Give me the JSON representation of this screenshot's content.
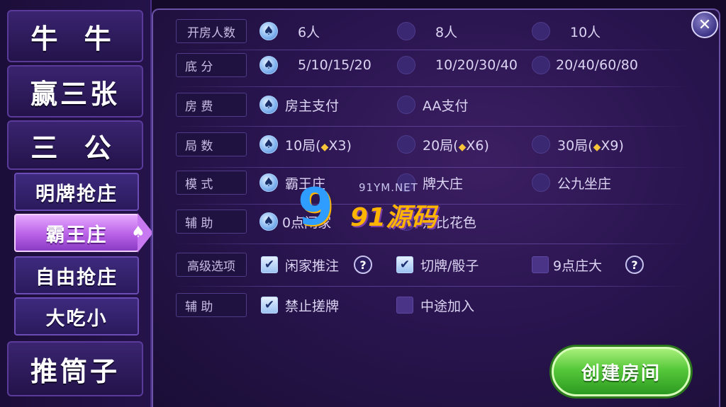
{
  "sidebar": {
    "games": [
      {
        "label": "牛 牛"
      },
      {
        "label": "赢三张"
      },
      {
        "label": "三 公"
      }
    ],
    "modes": [
      {
        "label": "明牌抢庄"
      },
      {
        "label": "霸王庄",
        "active": true
      },
      {
        "label": "自由抢庄"
      },
      {
        "label": "大吃小"
      }
    ],
    "bottom_game": {
      "label": "推筒子"
    }
  },
  "rows": {
    "players": {
      "label": "开房人数",
      "options": [
        "6人",
        "8人",
        "10人"
      ],
      "selected": 0
    },
    "base_score": {
      "label": "底 分",
      "options": [
        "5/10/15/20",
        "10/20/30/40",
        "20/40/60/80"
      ],
      "selected": 0
    },
    "room_fee": {
      "label": "房 费",
      "options": [
        "房主支付",
        "AA支付"
      ],
      "selected": 0
    },
    "rounds": {
      "label": "局 数",
      "options": [
        "10局(",
        "20局(",
        "30局("
      ],
      "multipliers": [
        "X3)",
        "X6)",
        "X9)"
      ],
      "selected": 0
    },
    "mode": {
      "label": "模 式",
      "options": [
        "霸王庄",
        "牌大庄",
        "公九坐庄"
      ],
      "selected": 0
    },
    "assist1": {
      "label": "辅 助",
      "options": [
        "0点闲家",
        "点比花色"
      ],
      "selected": 0
    },
    "advanced": {
      "label": "高级选项",
      "options": [
        "闲家推注",
        "切牌/骰子",
        "9点庄大"
      ],
      "checked": [
        true,
        true,
        false
      ]
    },
    "assist2": {
      "label": "辅 助",
      "options": [
        "禁止搓牌",
        "中途加入"
      ],
      "checked": [
        true,
        false
      ]
    }
  },
  "buttons": {
    "create": "创建房间",
    "close": "✕"
  },
  "icons": {
    "radio_on": "spade-icon",
    "check_on": "checkmark-icon",
    "help": "question-icon",
    "gem": "diamond-icon"
  },
  "watermark": {
    "nine": "9",
    "site": "91YM.NET",
    "brand": "91源码"
  },
  "colors": {
    "accent": "#7fb2ef",
    "button": "#56c83a",
    "active_tab": "#b860e6"
  }
}
